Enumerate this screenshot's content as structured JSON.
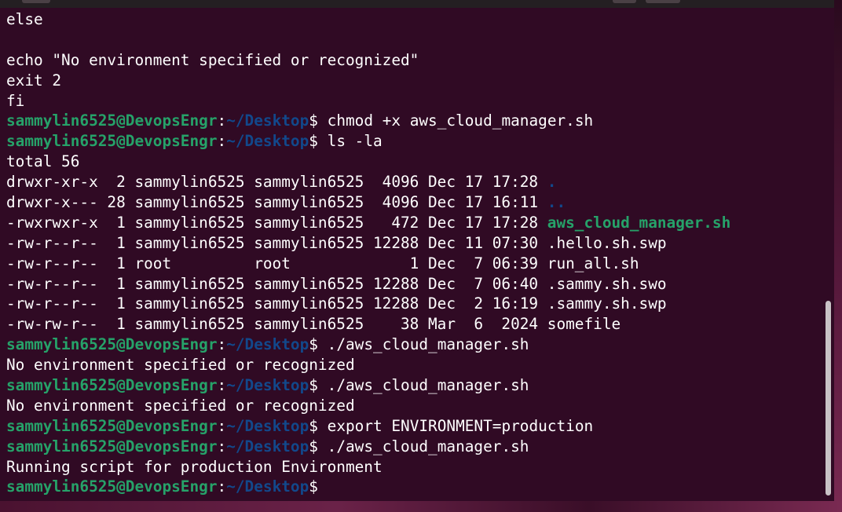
{
  "colors": {
    "background": "#300a24",
    "prompt_user": "#26a269",
    "prompt_path": "#12488b",
    "text": "#ffffff",
    "executable": "#26a269",
    "directory": "#12488b"
  },
  "prompt": {
    "user_host": "sammylin6525@DevopsEngr",
    "separator": ":",
    "path": "~/Desktop",
    "dollar": "$"
  },
  "lines": [
    {
      "type": "text",
      "text": "else"
    },
    {
      "type": "text",
      "text": ""
    },
    {
      "type": "text",
      "text": "echo \"No environment specified or recognized\""
    },
    {
      "type": "text",
      "text": "exit 2"
    },
    {
      "type": "text",
      "text": "fi"
    },
    {
      "type": "prompt",
      "command": " chmod +x aws_cloud_manager.sh"
    },
    {
      "type": "prompt",
      "command": " ls -la"
    },
    {
      "type": "text",
      "text": "total 56"
    },
    {
      "type": "ls",
      "meta": "drwxr-xr-x  2 sammylin6525 sammylin6525  4096 Dec 17 17:28 ",
      "name": ".",
      "kind": "dir"
    },
    {
      "type": "ls",
      "meta": "drwxr-x--- 28 sammylin6525 sammylin6525  4096 Dec 17 16:11 ",
      "name": "..",
      "kind": "dir"
    },
    {
      "type": "ls",
      "meta": "-rwxrwxr-x  1 sammylin6525 sammylin6525   472 Dec 17 17:28 ",
      "name": "aws_cloud_manager.sh",
      "kind": "exec"
    },
    {
      "type": "ls",
      "meta": "-rw-r--r--  1 sammylin6525 sammylin6525 12288 Dec 11 07:30 ",
      "name": ".hello.sh.swp",
      "kind": "file"
    },
    {
      "type": "ls",
      "meta": "-rw-r--r--  1 root         root             1 Dec  7 06:39 ",
      "name": "run_all.sh",
      "kind": "file"
    },
    {
      "type": "ls",
      "meta": "-rw-r--r--  1 sammylin6525 sammylin6525 12288 Dec  7 06:40 ",
      "name": ".sammy.sh.swo",
      "kind": "file"
    },
    {
      "type": "ls",
      "meta": "-rw-r--r--  1 sammylin6525 sammylin6525 12288 Dec  2 16:19 ",
      "name": ".sammy.sh.swp",
      "kind": "file"
    },
    {
      "type": "ls",
      "meta": "-rw-rw-r--  1 sammylin6525 sammylin6525    38 Mar  6  2024 ",
      "name": "somefile",
      "kind": "file"
    },
    {
      "type": "prompt",
      "command": " ./aws_cloud_manager.sh"
    },
    {
      "type": "text",
      "text": "No environment specified or recognized"
    },
    {
      "type": "prompt",
      "command": " ./aws_cloud_manager.sh"
    },
    {
      "type": "text",
      "text": "No environment specified or recognized"
    },
    {
      "type": "prompt",
      "command": " export ENVIRONMENT=production"
    },
    {
      "type": "prompt",
      "command": " ./aws_cloud_manager.sh"
    },
    {
      "type": "text",
      "text": "Running script for production Environment"
    },
    {
      "type": "prompt",
      "command": ""
    }
  ]
}
